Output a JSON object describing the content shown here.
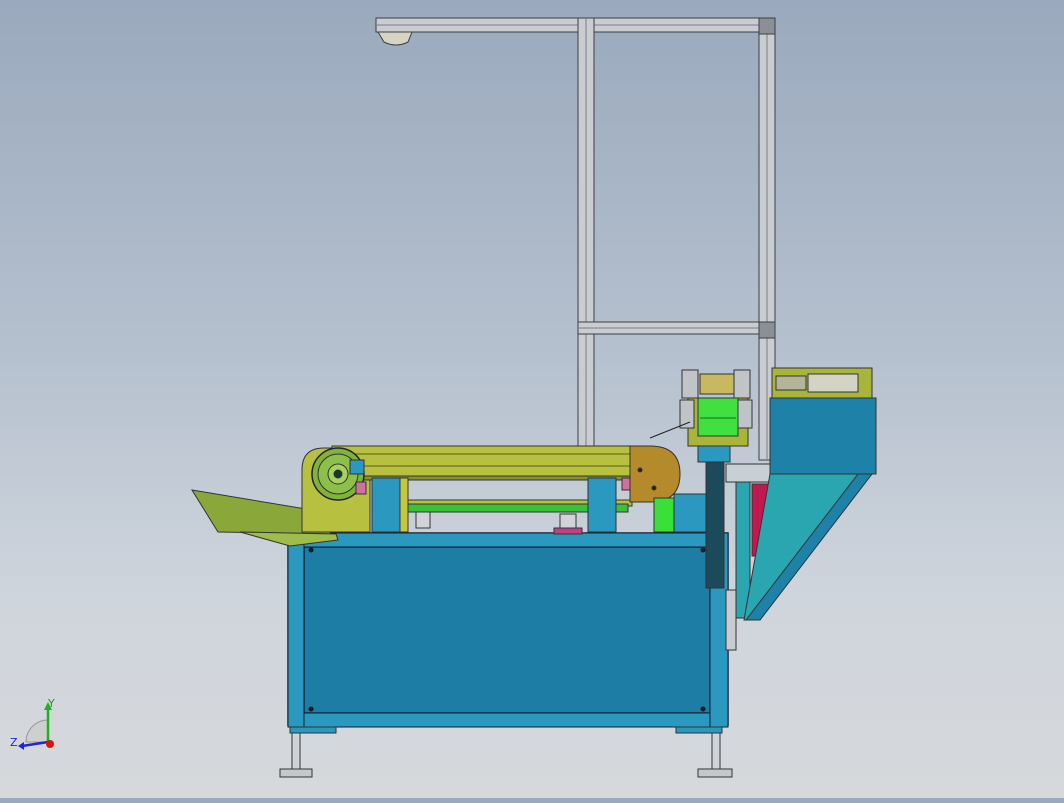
{
  "triad": {
    "y_label": "Y",
    "z_label": "Z",
    "y_color": "#1cb41c",
    "z_color": "#1c28d8",
    "x_color": "#e01010"
  },
  "colors": {
    "background_top": "#9aa9bd",
    "background_bottom": "#d6d8db",
    "frame_blue": "#1e82a8",
    "frame_teal": "#2aa6b0",
    "olive": "#a8b43a",
    "bronze": "#b48a2a",
    "green_roll": "#38e038",
    "magenta": "#c01850",
    "aluminum": "#c8ccd0"
  }
}
